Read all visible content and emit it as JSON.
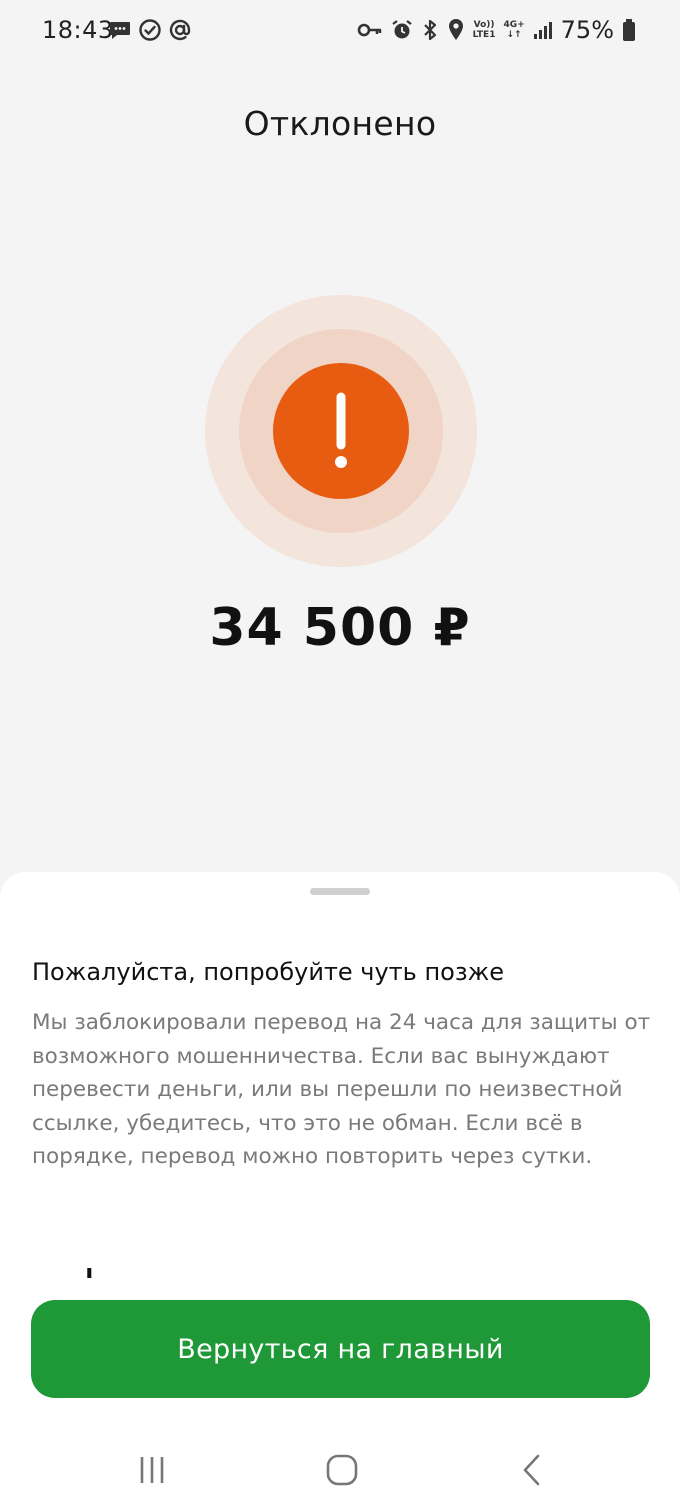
{
  "status_bar": {
    "time": "18:43",
    "battery": "75%",
    "network_top": "Vo))",
    "network_bottom": "LTE1",
    "network_type": "4G+"
  },
  "header": {
    "title": "Отклонено"
  },
  "transfer": {
    "amount": "34 500 ₽",
    "status_color": "#e85c12"
  },
  "sheet": {
    "heading": "Пожалуйста, попробуйте чуть позже",
    "body": "Мы заблокировали перевод на 24 часа для защиты от возможного мошенничества. Если вас вынуждают перевести деньги, или вы перешли по неизвестной ссылке, убедитесь, что это не обман. Если всё в порядке, перевод можно повторить через сутки."
  },
  "actions": {
    "primary_label": "Вернуться на главный",
    "primary_color": "#1f9838"
  },
  "icons": {
    "status_left": [
      "chat-bubble-icon",
      "check-circle-icon",
      "at-sign-icon"
    ],
    "status_right": [
      "key-icon",
      "alarm-icon",
      "bluetooth-icon",
      "location-icon",
      "signal-icon",
      "battery-icon"
    ],
    "main": "exclamation-icon",
    "nav": [
      "recents-icon",
      "home-icon",
      "back-icon"
    ]
  }
}
